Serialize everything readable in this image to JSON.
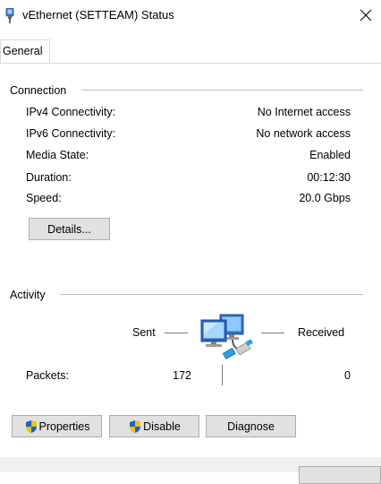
{
  "window": {
    "title": "vEthernet (SETTEAM) Status",
    "icon": "network-adapter-icon",
    "close_icon": "close-icon"
  },
  "tabs": [
    {
      "label": "General",
      "selected": true
    }
  ],
  "connection": {
    "heading": "Connection",
    "rows": [
      {
        "label": "IPv4 Connectivity:",
        "value": "No Internet access"
      },
      {
        "label": "IPv6 Connectivity:",
        "value": "No network access"
      },
      {
        "label": "Media State:",
        "value": "Enabled"
      },
      {
        "label": "Duration:",
        "value": "00:12:30"
      },
      {
        "label": "Speed:",
        "value": "20.0 Gbps"
      }
    ],
    "details_button": "Details..."
  },
  "activity": {
    "heading": "Activity",
    "sent_label": "Sent",
    "received_label": "Received",
    "packets_label": "Packets:",
    "packets_sent": "172",
    "packets_received": "0",
    "icon": "network-computers-icon"
  },
  "buttons": {
    "properties": "Properties",
    "disable": "Disable",
    "diagnose": "Diagnose",
    "shield_icon": "uac-shield-icon"
  },
  "colors": {
    "window_bg": "#ffffff",
    "footer_bg": "#f0f0f0",
    "button_bg": "#e1e1e1",
    "button_border": "#adadad",
    "group_line": "#bdbdbd"
  }
}
